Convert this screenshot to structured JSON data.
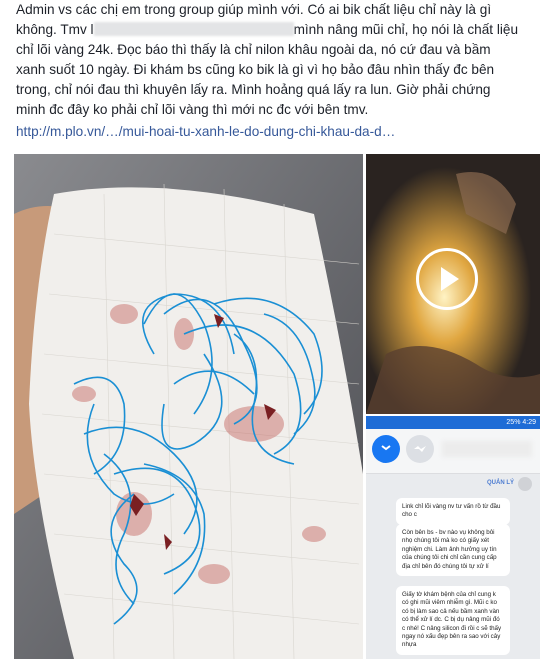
{
  "post": {
    "line1": "Admin vs các chị em trong group giúp mình với. Có ai bik chất liệu chỉ này là gì",
    "line2_start": "không. Tmv l",
    "line2_end": "mình nâng mũi chỉ, họ nói là chất liệu",
    "line3": "chỉ lõi vàng 24k. Đọc báo thì thấy là chỉ nilon khâu ngoài da, nó cứ đau và bầm",
    "line4": "xanh suốt 10 ngày. Đi khám bs cũng ko bik là gì vì họ bảo đâu nhìn thấy đc bên",
    "line5": "trong, chỉ nói đau thì khuyên lấy ra. Mình hoảng quá lấy ra lun. Giờ phải chứng",
    "line6": "minh đc đây ko phải chỉ lõi vàng thì mới nc đc với bên tmv.",
    "link": "http://m.plo.vn/…/mui-hoai-tu-xanh-le-do-dung-chi-khau-da-d…"
  },
  "chat": {
    "status": "25% 4:29",
    "manager_label": "QUẢN LÝ",
    "messages": [
      "Link chỉ lõi vàng nv tư vấn rồ từ đầu cho c",
      "Còn bên bs - bv nào vụ không bôi nhọ chúng tôi mà ko có giấy xét nghiệm chi. Làm ảnh hưởng uy tín của chúng tôi chi chỉ cần cung cấp địa chỉ bên đó chúng tôi tự xử lí",
      "Giấy tờ khám bệnh của chỉ cung k có ghi mũi viêm nhiễm gì. Mũi c ko có bị làm sao cả nếu bầm xanh vàn có thể xử lí dc. C bị dụ nâng mũi đó c nhé! C nâng silicon đi rồi c sẽ thấy ngay nó xấu đẹp bên ra sao với cây nhựa"
    ]
  },
  "colors": {
    "link": "#365899",
    "text": "#1d2129",
    "thread": "#1a8fd4",
    "play_circle": "#ffffff"
  }
}
